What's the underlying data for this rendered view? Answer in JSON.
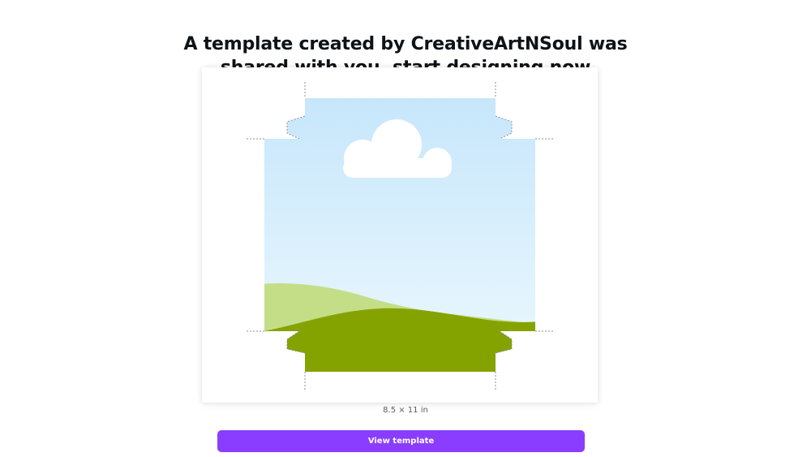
{
  "header": {
    "line1": "A template created by CreativeArtNSoul was",
    "line2": "shared with you, start designing now"
  },
  "preview": {
    "size_label": "8.5 × 11 in"
  },
  "cta": {
    "label": "View template"
  },
  "colors": {
    "accent": "#8b3dff",
    "sky_top": "#c6e6fb",
    "sky_bottom": "#eef9fe",
    "hill_light": "#c4de87",
    "hill_dark": "#85a300",
    "cloud": "#ffffff"
  }
}
